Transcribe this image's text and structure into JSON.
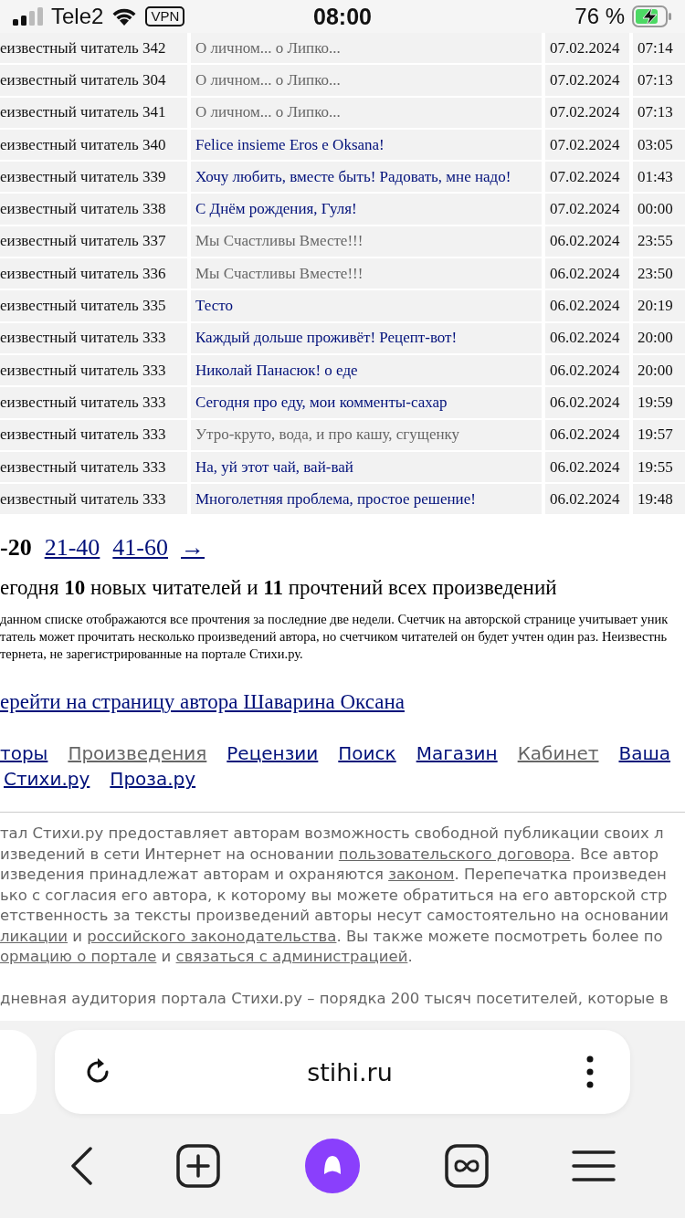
{
  "status_bar": {
    "carrier": "Tele2",
    "vpn": "VPN",
    "time": "08:00",
    "battery": "76 %",
    "charging": true
  },
  "rows": [
    {
      "reader": "еизвестный читатель 342",
      "title": "О личном... о Липко...",
      "date": "07.02.2024",
      "time": "07:14",
      "visited": true
    },
    {
      "reader": "еизвестный читатель 304",
      "title": "О личном... о Липко...",
      "date": "07.02.2024",
      "time": "07:13",
      "visited": true
    },
    {
      "reader": "еизвестный читатель 341",
      "title": "О личном... о Липко...",
      "date": "07.02.2024",
      "time": "07:13",
      "visited": true
    },
    {
      "reader": "еизвестный читатель 340",
      "title": "Felice insieme Eros e Oksana!",
      "date": "07.02.2024",
      "time": "03:05",
      "visited": false
    },
    {
      "reader": "еизвестный читатель 339",
      "title": "Хочу любить, вместе быть! Радовать, мне надо!",
      "date": "07.02.2024",
      "time": "01:43",
      "visited": false
    },
    {
      "reader": "еизвестный читатель 338",
      "title": "С Днём рождения, Гуля!",
      "date": "07.02.2024",
      "time": "00:00",
      "visited": false
    },
    {
      "reader": "еизвестный читатель 337",
      "title": "Мы Счастливы Вместе!!!",
      "date": "06.02.2024",
      "time": "23:55",
      "visited": true
    },
    {
      "reader": "еизвестный читатель 336",
      "title": "Мы Счастливы Вместе!!!",
      "date": "06.02.2024",
      "time": "23:50",
      "visited": true
    },
    {
      "reader": "еизвестный читатель 335",
      "title": "Тесто",
      "date": "06.02.2024",
      "time": "20:19",
      "visited": false
    },
    {
      "reader": "еизвестный читатель 333",
      "title": "Каждый дольше проживёт! Рецепт-вот!",
      "date": "06.02.2024",
      "time": "20:00",
      "visited": false
    },
    {
      "reader": "еизвестный читатель 333",
      "title": "Николай Панасюк! о еде",
      "date": "06.02.2024",
      "time": "20:00",
      "visited": false
    },
    {
      "reader": "еизвестный читатель 333",
      "title": "Сегодня про еду, мои комменты-сахар",
      "date": "06.02.2024",
      "time": "19:59",
      "visited": false
    },
    {
      "reader": "еизвестный читатель 333",
      "title": "Утро-круто, вода, и про кашу, сгущенку",
      "date": "06.02.2024",
      "time": "19:57",
      "visited": true
    },
    {
      "reader": "еизвестный читатель 333",
      "title": "На, уй этот чай, вай-вай",
      "date": "06.02.2024",
      "time": "19:55",
      "visited": false
    },
    {
      "reader": "еизвестный читатель 333",
      "title": "Многолетняя проблема, простое решение!",
      "date": "06.02.2024",
      "time": "19:48",
      "visited": false
    }
  ],
  "pagination": {
    "current": "-20",
    "pages": [
      "21-40",
      "41-60"
    ],
    "next": "→"
  },
  "summary": "егодня **10** новых читателей и **11** прочтений всех произведений",
  "notice_lines": [
    "данном списке отображаются все прочтения за последние две недели. Счетчик на авторской странице учитывает уник",
    "татель может прочитать несколько произведений автора, но счетчиком читателей он будет учтен один раз. Неизвестнь",
    "тернета, не зарегистрированные на портале Стихи.ру."
  ],
  "author_link": "ерейти на страницу автора Шаварина Оксана",
  "nav_rows": [
    [
      {
        "label": "торы",
        "visited": false
      },
      {
        "label": "Произведения",
        "visited": true
      },
      {
        "label": "Рецензии",
        "visited": false
      },
      {
        "label": "Поиск",
        "visited": false
      },
      {
        "label": "Магазин",
        "visited": false
      },
      {
        "label": "Кабинет",
        "visited": true
      },
      {
        "label": "Ваша",
        "visited": false
      }
    ],
    [
      {
        "label": "Стихи.ру",
        "visited": false
      },
      {
        "label": "Проза.ру",
        "visited": false
      }
    ]
  ],
  "footer_paragraphs": [
    [
      [
        {
          "text": "тал Стихи.ру предоставляет авторам возможность свободной публикации своих л",
          "link": false
        }
      ],
      [
        {
          "text": "изведений в сети Интернет на основании ",
          "link": false
        },
        {
          "text": "пользовательского договора",
          "link": true
        },
        {
          "text": ". Все автор",
          "link": false
        }
      ],
      [
        {
          "text": "изведения принадлежат авторам и охраняются ",
          "link": false
        },
        {
          "text": "законом",
          "link": true
        },
        {
          "text": ". Перепечатка произведен",
          "link": false
        }
      ],
      [
        {
          "text": "ько с согласия его автора, к которому вы можете обратиться на его авторской стр",
          "link": false
        }
      ],
      [
        {
          "text": "етственность за тексты произведений авторы несут самостоятельно на основании",
          "link": false
        }
      ],
      [
        {
          "text": "ликации",
          "link": true
        },
        {
          "text": " и ",
          "link": false
        },
        {
          "text": "российского законодательства",
          "link": true
        },
        {
          "text": ". Вы также можете посмотреть более по",
          "link": false
        }
      ],
      [
        {
          "text": "ормацию о портале",
          "link": true
        },
        {
          "text": " и ",
          "link": false
        },
        {
          "text": "связаться с администрацией",
          "link": true
        },
        {
          "text": ".",
          "link": false
        }
      ]
    ],
    [
      [
        {
          "text": "дневная аудитория портала Стихи.ру – порядка 200 тысяч посетителей, которые в",
          "link": false
        }
      ]
    ]
  ],
  "browser": {
    "address": "stihi.ru"
  }
}
